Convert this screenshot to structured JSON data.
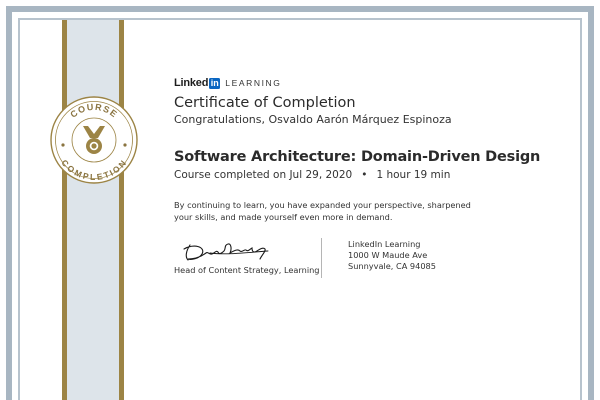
{
  "brand": {
    "linked": "Linked",
    "in": "in",
    "learning": "LEARNING",
    "colors": {
      "in_badge": "#0a66c2"
    }
  },
  "seal": {
    "top_text": "COURSE",
    "bottom_text": "COMPLETION",
    "icon": "medal-icon",
    "colors": {
      "gold": "#9c8445",
      "band": "#dde4ea"
    }
  },
  "certificate": {
    "title": "Certificate of Completion",
    "congrats": "Congratulations, Osvaldo Aarón Márquez Espinoza",
    "course_title": "Software Architecture: Domain-Driven Design",
    "completed_on": "Course completed on Jul 29, 2020",
    "separator": "•",
    "duration": "1 hour 19 min",
    "body": "By continuing to learn, you have expanded your perspective, sharpened your skills, and made yourself even more in demand."
  },
  "signature": {
    "signer_title": "Head of Content Strategy, Learning"
  },
  "address": {
    "line1": "LinkedIn Learning",
    "line2": "1000 W Maude Ave",
    "line3": "Sunnyvale, CA 94085"
  },
  "frame": {
    "colors": {
      "outer": "#a8b6c2",
      "inner": "#b7c3cd"
    }
  }
}
